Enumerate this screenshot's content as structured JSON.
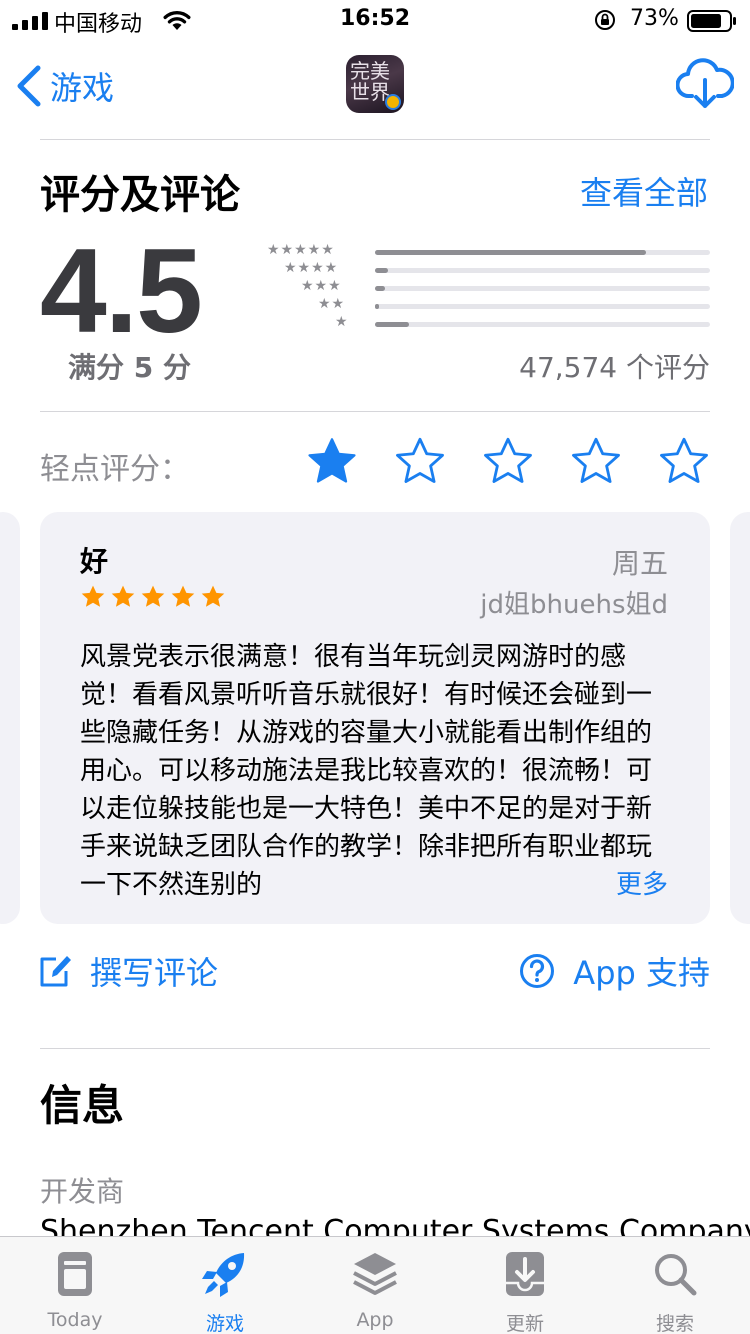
{
  "status_bar": {
    "carrier": "中国移动",
    "time": "16:52",
    "battery": "73%"
  },
  "nav": {
    "back_label": "游戏",
    "app_icon_text": "完美世界"
  },
  "ratings": {
    "title": "评分及评论",
    "see_all": "查看全部",
    "score": "4.5",
    "out_of": "满分 5 分",
    "count": "47,574 个评分",
    "histogram": [
      {
        "stars": 5,
        "fraction": 0.81
      },
      {
        "stars": 4,
        "fraction": 0.04
      },
      {
        "stars": 3,
        "fraction": 0.03
      },
      {
        "stars": 2,
        "fraction": 0.01
      },
      {
        "stars": 1,
        "fraction": 0.1
      }
    ],
    "tap_to_rate": "轻点评分：",
    "tap_selected": 1
  },
  "review": {
    "title": "好",
    "date": "周五",
    "author": "jd姐bhuehs姐d",
    "stars": 5,
    "body": "风景党表示很满意！很有当年玩剑灵网游时的感觉！看看风景听听音乐就很好！有时候还会碰到一些隐藏任务！从游戏的容量大小就能看出制作组的用心。可以移动施法是我比较喜欢的！很流畅！可以走位躲技能也是一大特色！美中不足的是对于新手来说缺乏团队合作的教学！除非把所有职业都玩一下不然连别的",
    "more": "更多"
  },
  "actions": {
    "write_review": "撰写评论",
    "app_support": "App 支持"
  },
  "info": {
    "title": "信息",
    "developer_label": "开发商",
    "developer_value": "Shenzhen Tencent Computer Systems Company"
  },
  "tabs": [
    {
      "label": "Today",
      "icon": "today-icon"
    },
    {
      "label": "游戏",
      "icon": "rocket-icon"
    },
    {
      "label": "App",
      "icon": "layers-icon"
    },
    {
      "label": "更新",
      "icon": "download-tray-icon"
    },
    {
      "label": "搜索",
      "icon": "search-icon"
    }
  ],
  "colors": {
    "accent": "#1a7ff0",
    "review_star": "#ff9500",
    "secondary_text": "#8e8e93",
    "card_background": "#f2f2f7"
  }
}
